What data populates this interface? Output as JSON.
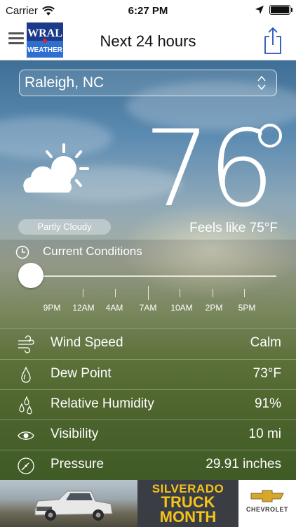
{
  "status_bar": {
    "carrier": "Carrier",
    "time": "6:27 PM"
  },
  "nav": {
    "title": "Next 24 hours",
    "logo_top": "WRAL",
    "logo_bottom": "WEATHER"
  },
  "location": {
    "selected": "Raleigh, NC"
  },
  "current": {
    "temperature": "76",
    "condition": "Partly Cloudy",
    "feels_like": "Feels like  75°F",
    "icon": "partly-cloudy-icon"
  },
  "timeline": {
    "label": "Current Conditions",
    "position": 0,
    "ticks": [
      "9PM",
      "12AM",
      "4AM",
      "7AM",
      "10AM",
      "2PM",
      "5PM"
    ]
  },
  "details": [
    {
      "label": "Wind Speed",
      "value": "Calm",
      "icon": "wind-icon"
    },
    {
      "label": "Dew Point",
      "value": "73°F",
      "icon": "droplet-icon"
    },
    {
      "label": "Relative Humidity",
      "value": "91%",
      "icon": "humidity-icon"
    },
    {
      "label": "Visibility",
      "value": "10 mi",
      "icon": "eye-icon"
    },
    {
      "label": "Pressure",
      "value": "29.91 inches",
      "icon": "gauge-icon"
    }
  ],
  "ad": {
    "line1": "SILVERADO",
    "line2": "TRUCK",
    "line3": "MONTH",
    "brand": "CHEVROLET"
  },
  "colors": {
    "accent_blue": "#2a52be",
    "text_white": "#ffffff",
    "promo_yellow": "#f4c41a"
  }
}
